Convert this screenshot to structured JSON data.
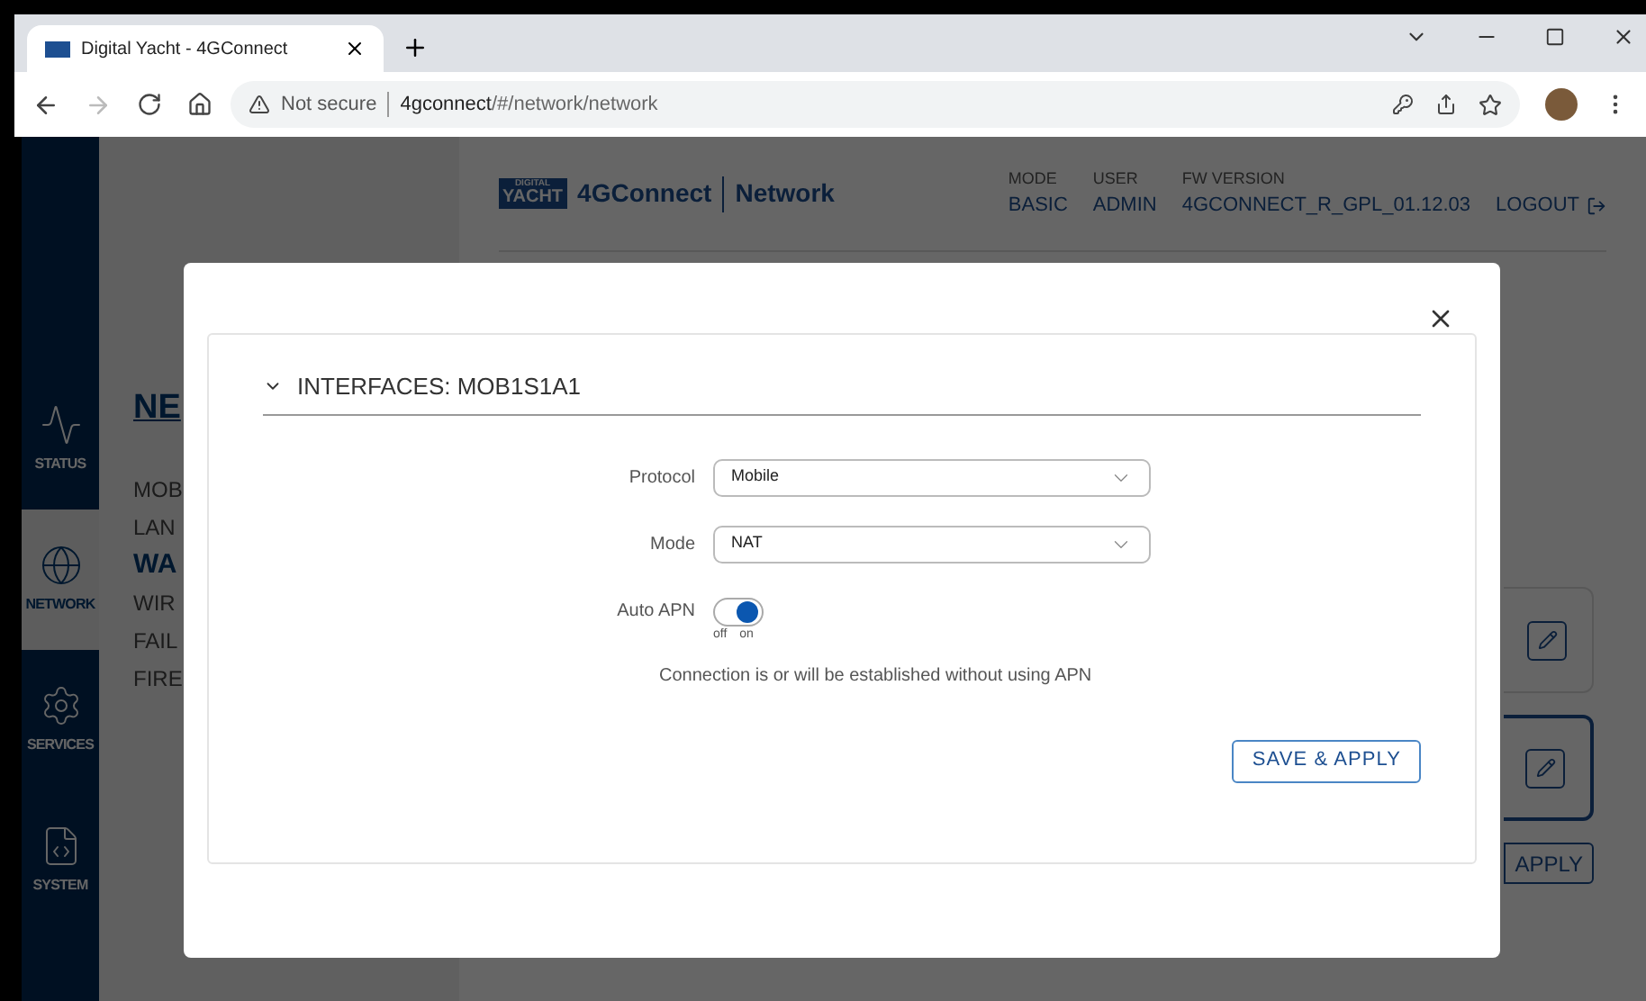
{
  "browser": {
    "tab_title": "Digital Yacht - 4GConnect",
    "security": "Not secure",
    "url_host": "4gconnect",
    "url_path": "/#/network/network"
  },
  "header": {
    "logo_top": "DIGITAL",
    "logo_bottom": "YACHT",
    "app": "4GConnect",
    "section": "Network",
    "logout": "LOGOUT",
    "info": [
      {
        "label": "MODE",
        "value": "BASIC"
      },
      {
        "label": "USER",
        "value": "ADMIN"
      },
      {
        "label": "FW VERSION",
        "value": "4GCONNECT_R_GPL_01.12.03"
      }
    ]
  },
  "sidebar": {
    "items": [
      {
        "kind": "status",
        "label": "STATUS",
        "selected": false
      },
      {
        "kind": "network",
        "label": "NETWORK",
        "selected": true
      },
      {
        "kind": "services",
        "label": "SERVICES",
        "selected": false
      },
      {
        "kind": "system",
        "label": "SYSTEM",
        "selected": false
      }
    ]
  },
  "page": {
    "heading": "NE",
    "menu": [
      {
        "label": "MOB",
        "selected": false
      },
      {
        "label": "LAN",
        "selected": false
      },
      {
        "label": "WA",
        "selected": true
      },
      {
        "label": "WIR",
        "selected": false
      },
      {
        "label": "FAIL",
        "selected": false
      },
      {
        "label": "FIRE",
        "selected": false
      }
    ],
    "edit_cards": [
      {
        "highlighted": false
      },
      {
        "highlighted": true
      }
    ],
    "apply_button": "APPLY"
  },
  "modal": {
    "section_title": "INTERFACES: MOB1S1A1",
    "expanded": true,
    "fields": [
      {
        "kind": "select",
        "label": "Protocol",
        "value": "Mobile"
      },
      {
        "kind": "select",
        "label": "Mode",
        "value": "NAT"
      },
      {
        "kind": "toggle",
        "label": "Auto APN",
        "on": true,
        "off_label": "off",
        "on_label": "on"
      }
    ],
    "help": "Connection is or will be established without using APN",
    "save_button": "SAVE & APPLY"
  }
}
